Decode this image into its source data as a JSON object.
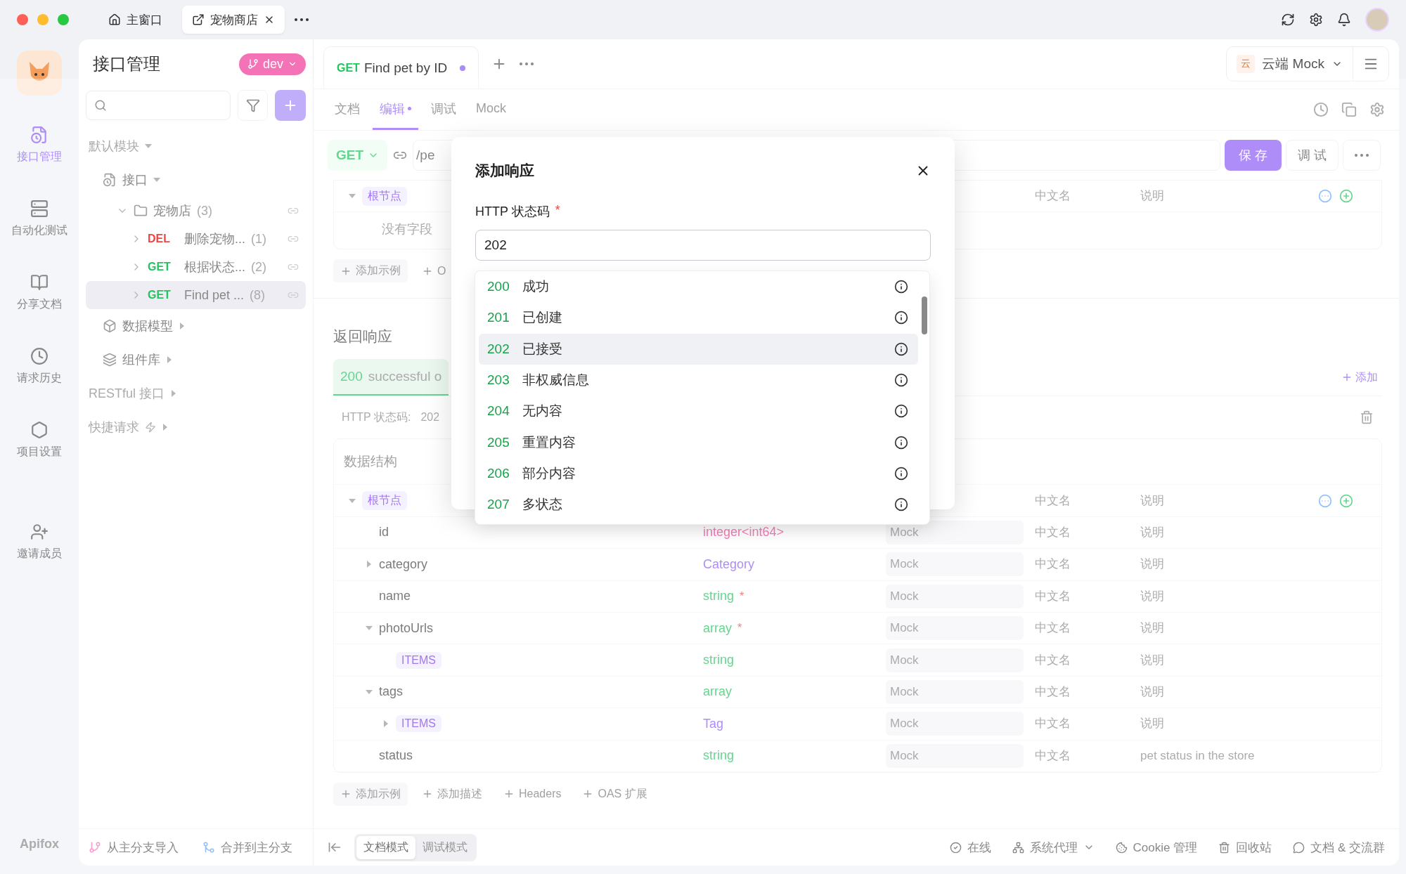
{
  "title_bar": {
    "tabs": [
      {
        "label": "主窗口",
        "selected": false,
        "closable": false
      },
      {
        "label": "宠物商店",
        "selected": true,
        "closable": true
      }
    ]
  },
  "rail": {
    "items": [
      {
        "label": "接口管理",
        "selected": true
      },
      {
        "label": "自动化测试",
        "selected": false
      },
      {
        "label": "分享文档",
        "selected": false
      },
      {
        "label": "请求历史",
        "selected": false
      },
      {
        "label": "项目设置",
        "selected": false
      },
      {
        "label": "邀请成员",
        "selected": false
      }
    ],
    "brand": "Apifox"
  },
  "sidebar": {
    "title": "接口管理",
    "branch": "dev",
    "tree": [
      {
        "kind": "module",
        "label": "默认模块",
        "expanded": true
      },
      {
        "kind": "interfaces",
        "label": "接口",
        "expanded": true,
        "children": [
          {
            "kind": "folder",
            "label": "宠物店",
            "count": "(3)",
            "expanded": true,
            "children": [
              {
                "kind": "endpoint",
                "method": "DEL",
                "color": "#ef4444",
                "label": "删除宠物...",
                "count": "(1)",
                "expanded": false,
                "selected": false
              },
              {
                "kind": "endpoint",
                "method": "GET",
                "color": "#22c55e",
                "label": "根据状态...",
                "count": "(2)",
                "expanded": false,
                "selected": false
              },
              {
                "kind": "endpoint",
                "method": "GET",
                "color": "#22c55e",
                "label": "Find pet ...",
                "count": "(8)",
                "expanded": false,
                "selected": true
              }
            ]
          }
        ]
      },
      {
        "kind": "models",
        "label": "数据模型",
        "expanded": false
      },
      {
        "kind": "components",
        "label": "组件库",
        "expanded": false
      },
      {
        "kind": "module",
        "label": "RESTful 接口",
        "expanded": false
      },
      {
        "kind": "quick",
        "label": "快捷请求",
        "expanded": false
      }
    ],
    "footer": [
      "从主分支导入",
      "合并到主分支"
    ]
  },
  "endpoint_tab": {
    "method": "GET",
    "title": "Find pet by ID",
    "unsaved": true
  },
  "mock_env": {
    "badge": "云",
    "label": "云端 Mock"
  },
  "subtabs": [
    {
      "label": "文档",
      "selected": false,
      "dirty": false
    },
    {
      "label": "编辑",
      "selected": true,
      "dirty": true
    },
    {
      "label": "调试",
      "selected": false,
      "dirty": false
    },
    {
      "label": "Mock",
      "selected": false,
      "dirty": false
    }
  ],
  "request": {
    "method": "GET",
    "path": "/pe",
    "save": "保 存",
    "debug": "调 试"
  },
  "request_body": {
    "root": "根节点",
    "expanded": true,
    "cn_placeholder": "中文名",
    "note_placeholder": "说明",
    "empty": "没有字段",
    "actions": [
      "添加示例",
      "O"
    ]
  },
  "responses": {
    "title": "返回响应",
    "add": "添加",
    "tabs": [
      {
        "code": "200",
        "name": "successful o",
        "selected": true
      }
    ],
    "status_label": "HTTP 状态码:",
    "status_value": "202",
    "schema_title": "数据结构",
    "schema": [
      {
        "name": "根节点",
        "pill": true,
        "expanded": true,
        "cn_placeholder": "中文名",
        "note_placeholder": "说明",
        "children": [
          {
            "name": "id",
            "pill": false,
            "type": "integer<int64>",
            "kind": "integer",
            "mock_placeholder": "Mock",
            "cn_placeholder": "中文名",
            "note_placeholder": "说明"
          },
          {
            "name": "category",
            "pill": false,
            "type": "Category",
            "kind": "ref",
            "expanded": false,
            "mock_placeholder": "Mock",
            "cn_placeholder": "中文名",
            "note_placeholder": "说明"
          },
          {
            "name": "name",
            "pill": false,
            "type": "string",
            "kind": "string",
            "required_mark": "*",
            "mock_placeholder": "Mock",
            "cn_placeholder": "中文名",
            "note_placeholder": "说明"
          },
          {
            "name": "photoUrls",
            "pill": false,
            "type": "array",
            "kind": "array",
            "required_mark": "*",
            "expanded": true,
            "mock_placeholder": "Mock",
            "cn_placeholder": "中文名",
            "note_placeholder": "说明",
            "children": [
              {
                "name": "ITEMS",
                "pill": true,
                "type": "string",
                "kind": "string",
                "mock_placeholder": "Mock",
                "cn_placeholder": "中文名",
                "note_placeholder": "说明"
              }
            ]
          },
          {
            "name": "tags",
            "pill": false,
            "type": "array",
            "kind": "array",
            "expanded": true,
            "mock_placeholder": "Mock",
            "cn_placeholder": "中文名",
            "note_placeholder": "说明",
            "children": [
              {
                "name": "ITEMS",
                "pill": true,
                "type": "Tag",
                "kind": "ref",
                "expanded": false,
                "mock_placeholder": "Mock",
                "cn_placeholder": "中文名",
                "note_placeholder": "说明"
              }
            ]
          },
          {
            "name": "status",
            "pill": false,
            "type": "string",
            "kind": "string",
            "mock_placeholder": "Mock",
            "cn_placeholder": "中文名",
            "note": "pet status in the store"
          }
        ]
      }
    ],
    "actions": [
      "添加示例",
      "添加描述",
      "Headers",
      "OAS 扩展"
    ]
  },
  "status_bar": {
    "modes": [
      {
        "label": "文档模式",
        "selected": true
      },
      {
        "label": "调试模式",
        "selected": false
      }
    ],
    "items": [
      {
        "label": "在线",
        "dropdown": false
      },
      {
        "label": "系统代理",
        "dropdown": true
      },
      {
        "label": "Cookie 管理",
        "dropdown": false
      },
      {
        "label": "回收站",
        "dropdown": false
      },
      {
        "label": "文档 & 交流群",
        "dropdown": false
      }
    ]
  },
  "modal": {
    "title": "添加响应",
    "field_label": "HTTP 状态码",
    "required_mark": "*",
    "value": "202",
    "options": [
      {
        "code": "200",
        "label": "成功",
        "selected": false
      },
      {
        "code": "201",
        "label": "已创建",
        "selected": false
      },
      {
        "code": "202",
        "label": "已接受",
        "selected": true
      },
      {
        "code": "203",
        "label": "非权威信息",
        "selected": false
      },
      {
        "code": "204",
        "label": "无内容",
        "selected": false
      },
      {
        "code": "205",
        "label": "重置内容",
        "selected": false
      },
      {
        "code": "206",
        "label": "部分内容",
        "selected": false
      },
      {
        "code": "207",
        "label": "多状态",
        "selected": false
      }
    ]
  }
}
